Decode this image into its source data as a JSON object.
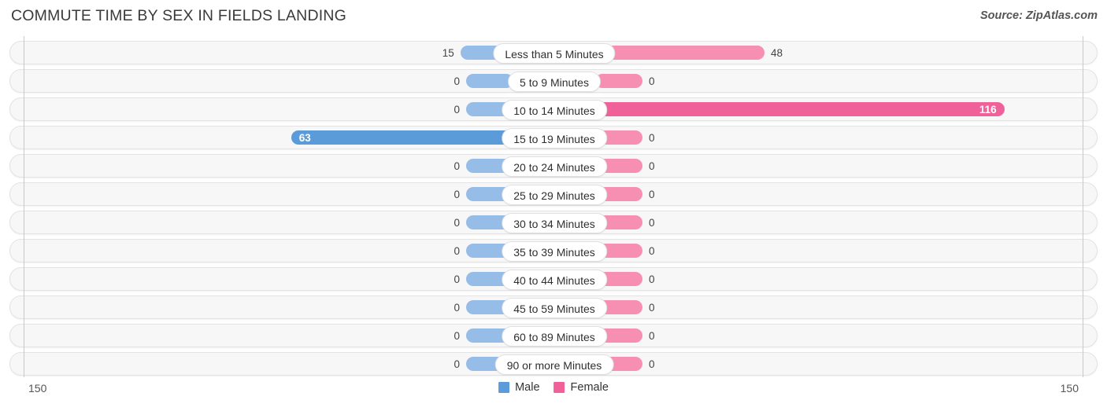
{
  "header": {
    "title": "COMMUTE TIME BY SEX IN FIELDS LANDING",
    "source": "Source: ZipAtlas.com"
  },
  "legend": {
    "male_label": "Male",
    "female_label": "Female",
    "male_color": "#5b9bd9",
    "female_color": "#f0619a"
  },
  "axis": {
    "left_tick": "150",
    "right_tick": "150",
    "max": 150
  },
  "colors": {
    "male_light": "#95bde8",
    "male_dark": "#5b9bd9",
    "female_light": "#f78fb3",
    "female_dark": "#f0619a",
    "row_background": "#f7f7f7",
    "row_border": "#e3e3e3",
    "capsule_background": "#ffffff"
  },
  "chart_data": {
    "type": "bar",
    "title": "COMMUTE TIME BY SEX IN FIELDS LANDING",
    "subtitle": "",
    "xlabel": "",
    "ylabel": "",
    "orientation": "horizontal",
    "style": "diverging-butterfly",
    "xlim": [
      150,
      150
    ],
    "grid": false,
    "legend_position": "bottom-center",
    "categories": [
      "Less than 5 Minutes",
      "5 to 9 Minutes",
      "10 to 14 Minutes",
      "15 to 19 Minutes",
      "20 to 24 Minutes",
      "25 to 29 Minutes",
      "30 to 34 Minutes",
      "35 to 39 Minutes",
      "40 to 44 Minutes",
      "45 to 59 Minutes",
      "60 to 89 Minutes",
      "90 or more Minutes"
    ],
    "series": [
      {
        "name": "Male",
        "side": "left",
        "values": [
          15,
          0,
          0,
          63,
          0,
          0,
          0,
          0,
          0,
          0,
          0,
          0
        ]
      },
      {
        "name": "Female",
        "side": "right",
        "values": [
          48,
          0,
          116,
          0,
          0,
          0,
          0,
          0,
          0,
          0,
          0,
          0
        ]
      }
    ]
  },
  "rows": [
    {
      "label": "Less than 5 Minutes",
      "male": 15,
      "female": 48,
      "male_text": "15",
      "female_text": "48",
      "male_highlight": false,
      "female_highlight": false
    },
    {
      "label": "5 to 9 Minutes",
      "male": 0,
      "female": 0,
      "male_text": "0",
      "female_text": "0",
      "male_highlight": false,
      "female_highlight": false
    },
    {
      "label": "10 to 14 Minutes",
      "male": 0,
      "female": 116,
      "male_text": "0",
      "female_text": "116",
      "male_highlight": false,
      "female_highlight": true
    },
    {
      "label": "15 to 19 Minutes",
      "male": 63,
      "female": 0,
      "male_text": "63",
      "female_text": "0",
      "male_highlight": true,
      "female_highlight": false
    },
    {
      "label": "20 to 24 Minutes",
      "male": 0,
      "female": 0,
      "male_text": "0",
      "female_text": "0",
      "male_highlight": false,
      "female_highlight": false
    },
    {
      "label": "25 to 29 Minutes",
      "male": 0,
      "female": 0,
      "male_text": "0",
      "female_text": "0",
      "male_highlight": false,
      "female_highlight": false
    },
    {
      "label": "30 to 34 Minutes",
      "male": 0,
      "female": 0,
      "male_text": "0",
      "female_text": "0",
      "male_highlight": false,
      "female_highlight": false
    },
    {
      "label": "35 to 39 Minutes",
      "male": 0,
      "female": 0,
      "male_text": "0",
      "female_text": "0",
      "male_highlight": false,
      "female_highlight": false
    },
    {
      "label": "40 to 44 Minutes",
      "male": 0,
      "female": 0,
      "male_text": "0",
      "female_text": "0",
      "male_highlight": false,
      "female_highlight": false
    },
    {
      "label": "45 to 59 Minutes",
      "male": 0,
      "female": 0,
      "male_text": "0",
      "female_text": "0",
      "male_highlight": false,
      "female_highlight": false
    },
    {
      "label": "60 to 89 Minutes",
      "male": 0,
      "female": 0,
      "male_text": "0",
      "female_text": "0",
      "male_highlight": false,
      "female_highlight": false
    },
    {
      "label": "90 or more Minutes",
      "male": 0,
      "female": 0,
      "male_text": "0",
      "female_text": "0",
      "male_highlight": false,
      "female_highlight": false
    }
  ]
}
